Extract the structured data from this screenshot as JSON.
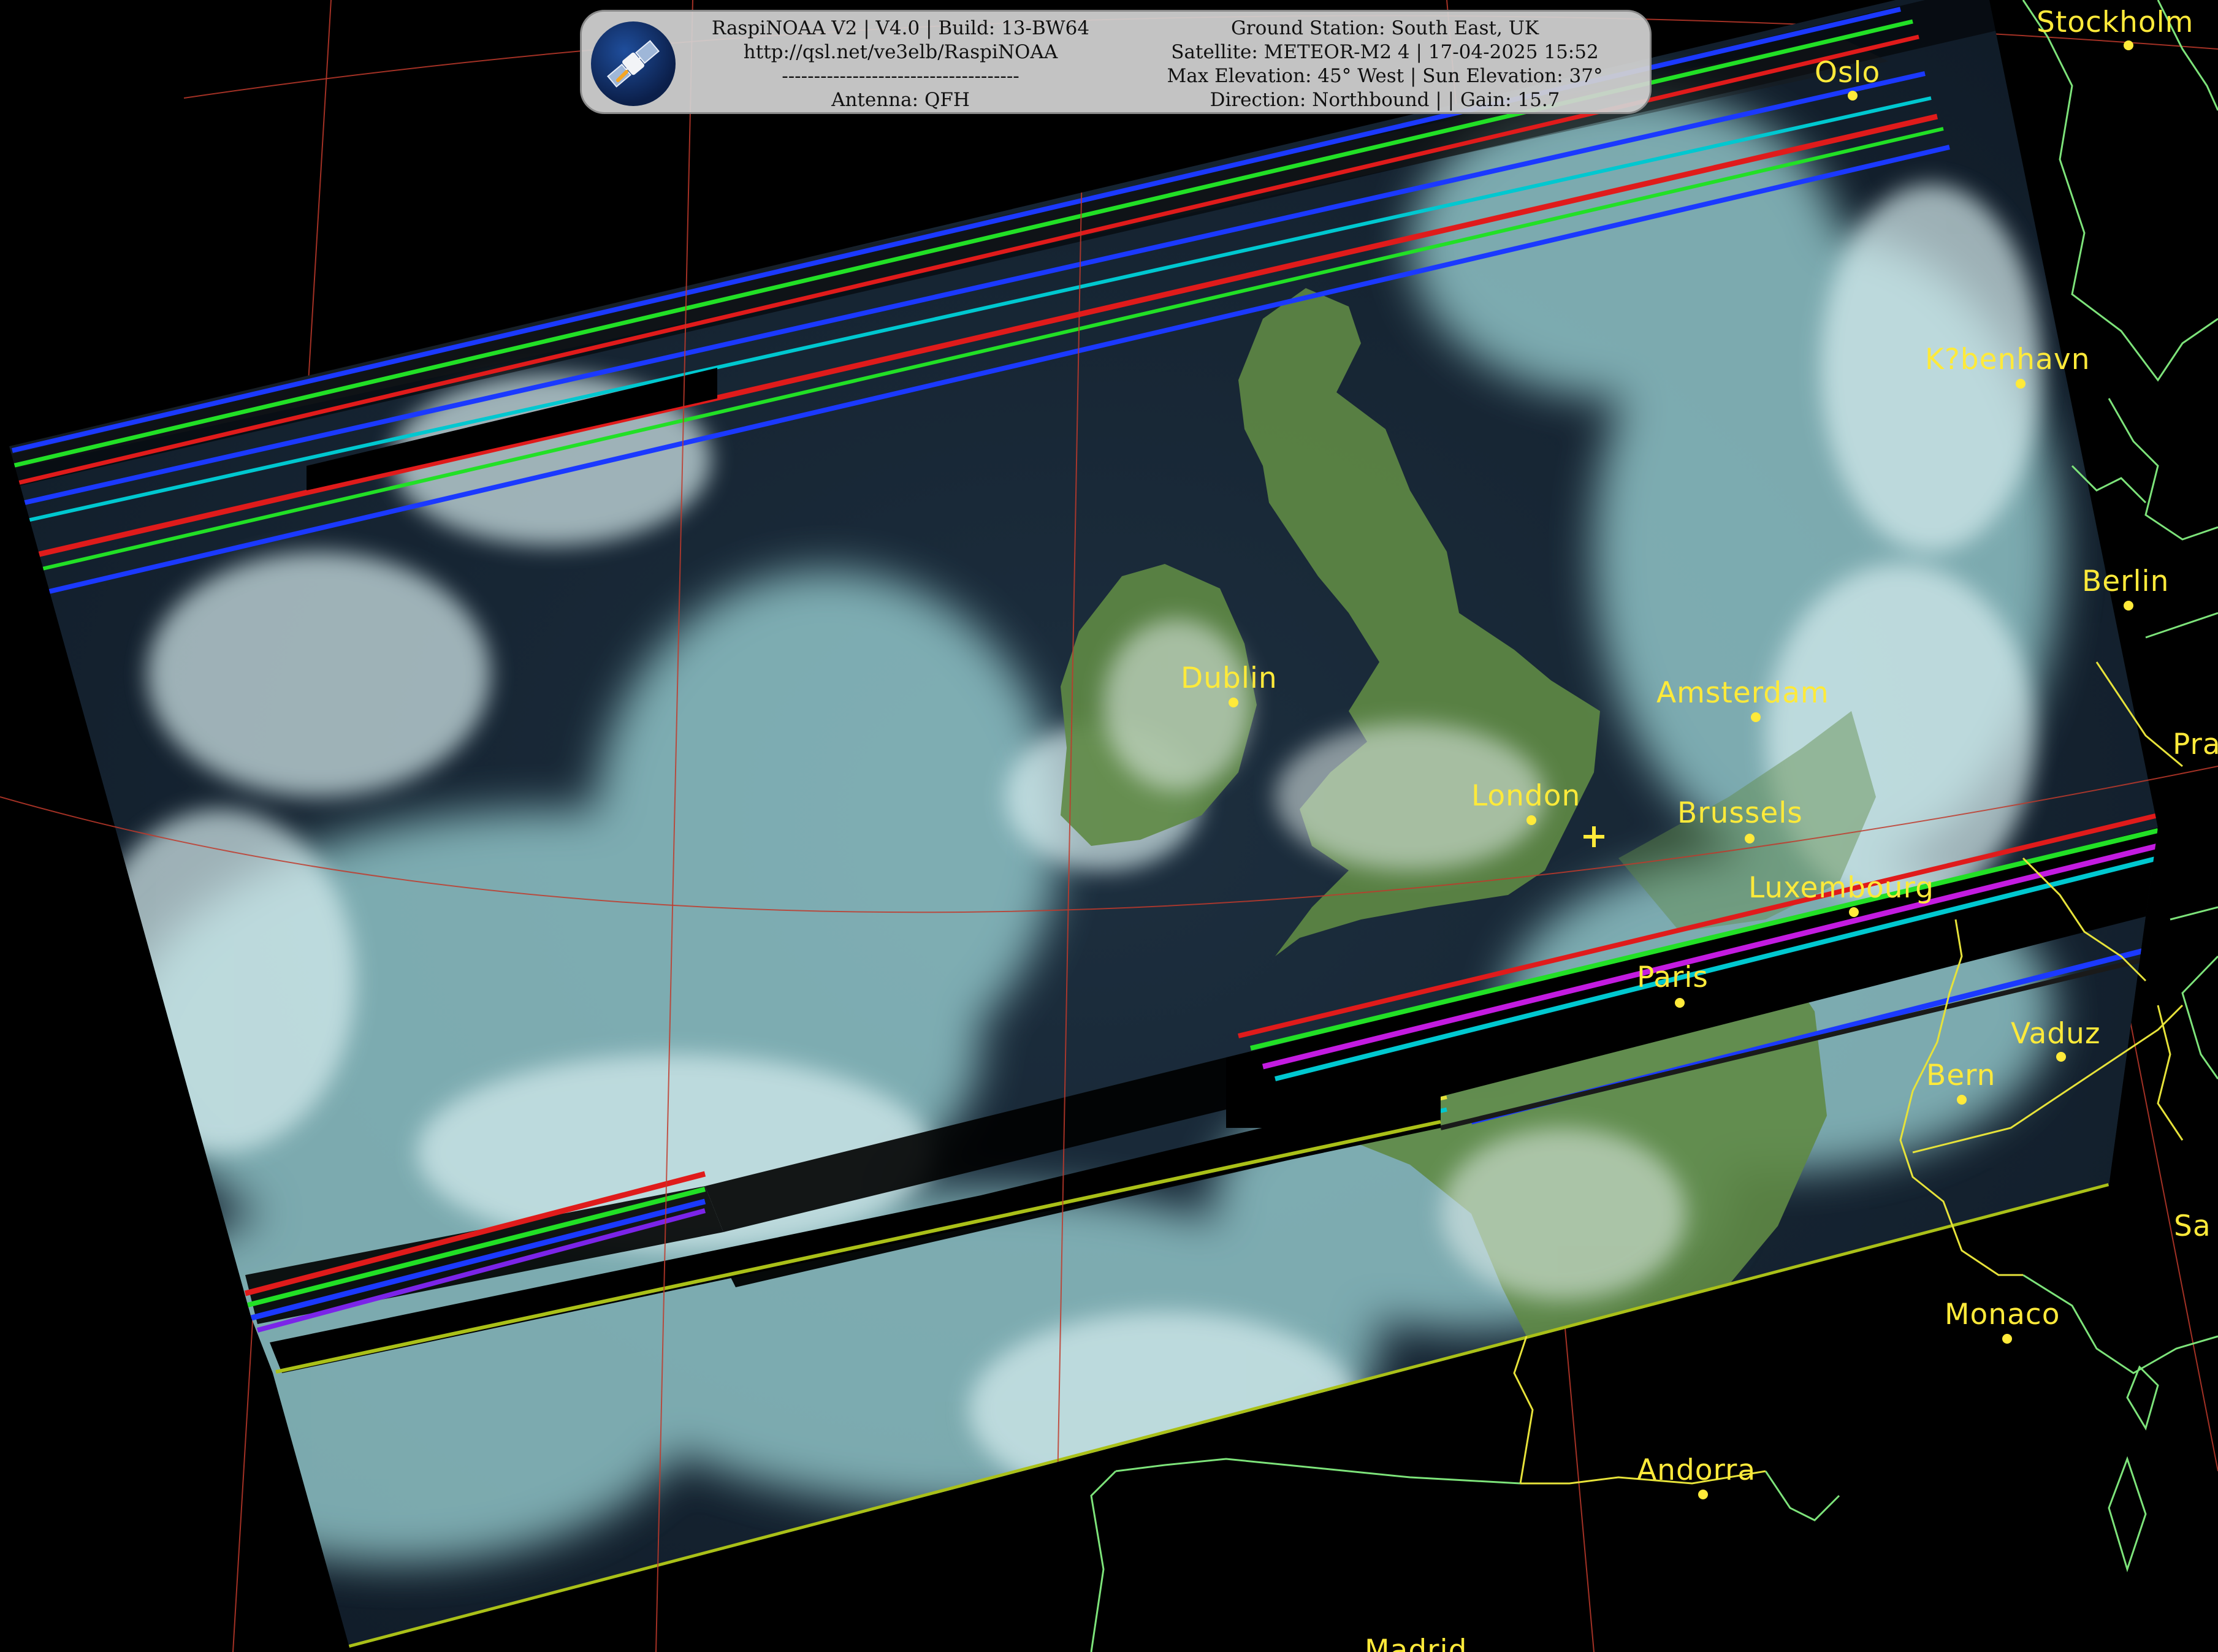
{
  "header": {
    "left": {
      "software": "RaspiNOAA V2 | V4.0 | Build: 13-BW64",
      "url": "http://qsl.net/ve3elb/RaspiNOAA",
      "separator": "-------------------------------------",
      "antenna": "Antenna: QFH"
    },
    "right": {
      "station": "Ground Station: South East, UK",
      "satellite": "Satellite: METEOR-M2 4 | 17-04-2025 15:52",
      "elevation": "Max Elevation: 45° West | Sun Elevation: 37°",
      "direction": "Direction: Northbound | | Gain: 15.7"
    },
    "logo_icon": "satellite-icon"
  },
  "cities": [
    {
      "key": "stockholm",
      "name": "Stockholm"
    },
    {
      "key": "oslo",
      "name": "Oslo"
    },
    {
      "key": "kobenhavn",
      "name": "K?benhavn"
    },
    {
      "key": "berlin",
      "name": "Berlin"
    },
    {
      "key": "praha",
      "name": "Pra"
    },
    {
      "key": "dublin",
      "name": "Dublin"
    },
    {
      "key": "amsterdam",
      "name": "Amsterdam"
    },
    {
      "key": "london",
      "name": "London"
    },
    {
      "key": "brussels",
      "name": "Brussels"
    },
    {
      "key": "luxembourg",
      "name": "Luxembourg"
    },
    {
      "key": "paris",
      "name": "Paris"
    },
    {
      "key": "vaduz",
      "name": "Vaduz"
    },
    {
      "key": "bern",
      "name": "Bern"
    },
    {
      "key": "san-marino",
      "name": "Sa"
    },
    {
      "key": "monaco",
      "name": "Monaco"
    },
    {
      "key": "andorra",
      "name": "Andorra"
    },
    {
      "key": "madrid",
      "name": "Madrid"
    }
  ],
  "colors": {
    "city_label": "#ffea3a",
    "coastline": "#7de37a",
    "border": "#e6e23a",
    "graticule": "#c0392b",
    "ground_station_marker": "#ffea3a"
  }
}
